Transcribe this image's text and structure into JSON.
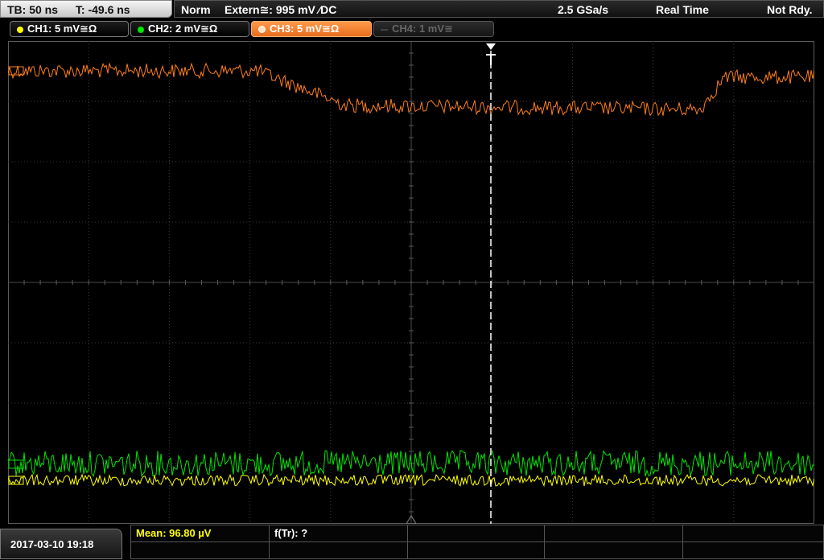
{
  "status_bar": {
    "timebase": "TB: 50 ns",
    "trigger_position": "T: -49.6 ns",
    "trigger_mode": "Norm",
    "trigger_source": "Extern≅: 995 mV ⁄DC",
    "sample_rate": "2.5 GSa/s",
    "acquisition": "Real Time",
    "state": "Not Rdy."
  },
  "channels": [
    {
      "label": "CH1: 5 mV≅Ω",
      "color": "#ffff00",
      "active": true
    },
    {
      "label": "CH2: 2 mV≅Ω",
      "color": "#00e600",
      "active": true
    },
    {
      "label": "CH3: 5 mV≅Ω",
      "color": "#ff7f1a",
      "active": true,
      "selected": true
    },
    {
      "label": "CH4: 1 mV≅",
      "color": "#6a6a6a",
      "active": false
    }
  ],
  "measurements": {
    "mean": "Mean: 96.80 µV",
    "frequency": "f(Tr): ?"
  },
  "timestamp": "2017-03-10 19:18",
  "colors": {
    "grid": "#555555",
    "trigger_marker": "#ffffff",
    "ch3_trace": "#ff7f1a",
    "ch2_trace": "#00e600",
    "ch1_trace": "#ffff00",
    "measurement_text": "#ffff00"
  },
  "icons": [
    "trigger-position-marker-icon",
    "reference-marker-icon",
    "channel-offset-marker-icon"
  ]
}
